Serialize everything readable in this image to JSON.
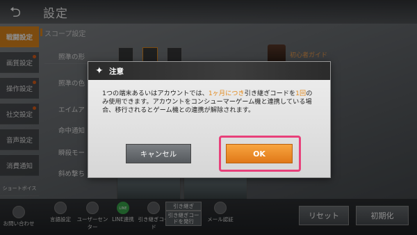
{
  "header": {
    "title": "設定",
    "back_icon": "back-arrow-icon"
  },
  "sidebar": {
    "items": [
      {
        "label": "戦闘設定",
        "active": true
      },
      {
        "label": "画質設定",
        "active": false
      },
      {
        "label": "操作設定",
        "active": false
      },
      {
        "label": "社交設定",
        "active": false
      },
      {
        "label": "音声設定",
        "active": false
      },
      {
        "label": "消費通知",
        "active": false
      },
      {
        "label": "ショートボイス",
        "active": false
      }
    ],
    "support": "お問い合わせ"
  },
  "settings": {
    "section": "スコープ設定",
    "rows": [
      "照準の形",
      "照準の色",
      "エイムア",
      "命中通知",
      "瞬殺モー",
      "斜め撃ち"
    ],
    "guide": "初心者ガイド"
  },
  "footer": {
    "items": [
      "言語設定",
      "ユーザーセンター",
      "LINE連携",
      "引き継ぎコード",
      "メール認証"
    ],
    "line_icon_text": "LINE",
    "transfer_buttons": [
      "引き継ぎ",
      "引き継ぎコードを発行"
    ],
    "reset": "リセット",
    "init": "初期化"
  },
  "dialog": {
    "title": "注意",
    "body_parts": [
      "1つの端末あるいはアカウントでは、",
      "1ヶ月につき",
      "引き継ぎコードを",
      "1回",
      "のみ使用できます。アカウントをコンシューマーゲーム機と連携している場合、移行されるとゲーム機との連携が解除されます。"
    ],
    "cancel": "キャンセル",
    "ok": "OK"
  },
  "colors": {
    "accent": "#e2891c",
    "highlight": "#e8407a",
    "ok_button": "#f39a30"
  }
}
